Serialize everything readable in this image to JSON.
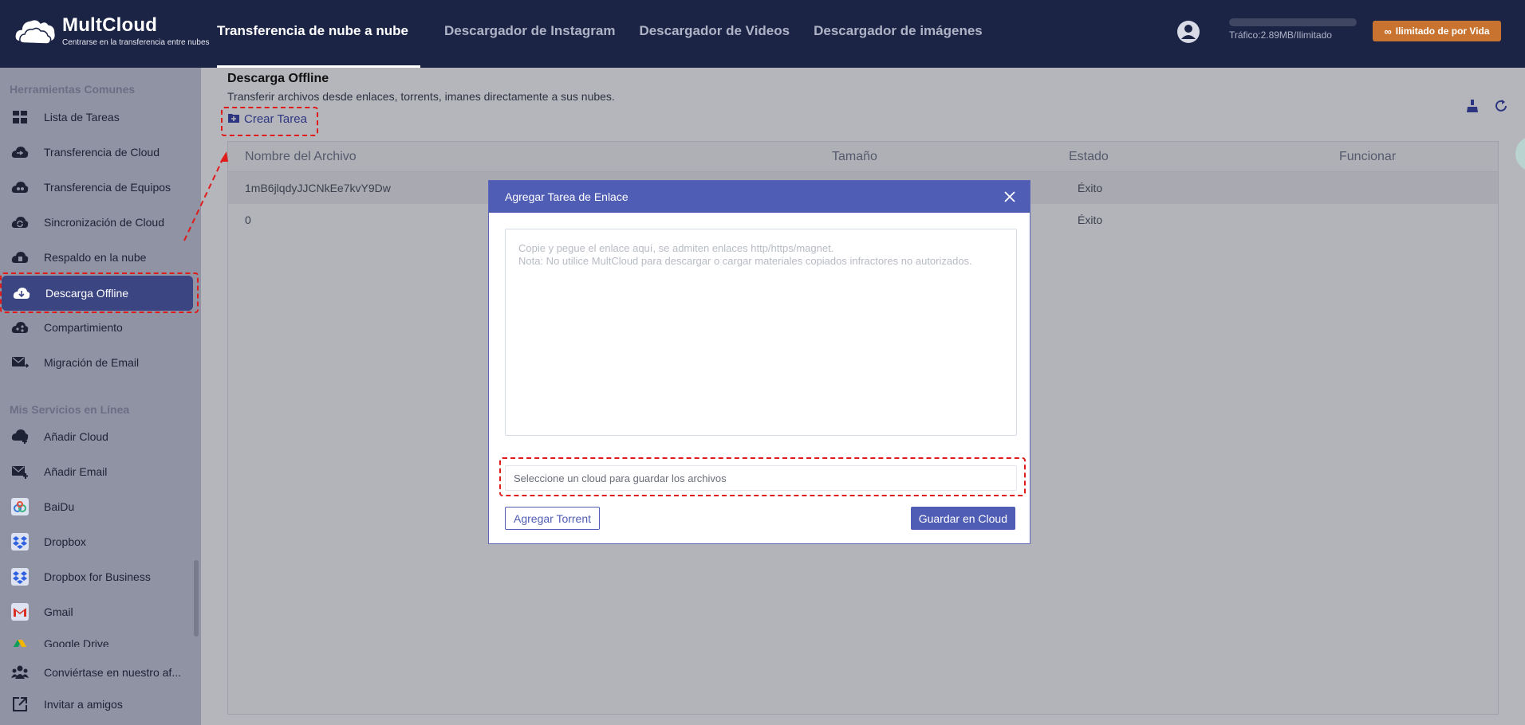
{
  "header": {
    "logo_title": "MultCloud",
    "logo_subtitle": "Centrarse en la transferencia entre nubes",
    "nav": [
      {
        "label": "Transferencia de nube a nube",
        "active": true
      },
      {
        "label": "Descargador de Instagram"
      },
      {
        "label": "Descargador de Videos"
      },
      {
        "label": "Descargador de imágenes"
      }
    ],
    "traffic": "Tráfico:2.89MB/Ilimitado",
    "vip_label": "Ilimitado de por Vida"
  },
  "sidebar": {
    "section_tools": "Herramientas Comunes",
    "tools": [
      {
        "label": "Lista de Tareas",
        "icon": "grid-icon"
      },
      {
        "label": "Transferencia de Cloud",
        "icon": "cloud-transfer-icon"
      },
      {
        "label": "Transferencia de Equipos",
        "icon": "team-transfer-icon"
      },
      {
        "label": "Sincronización de Cloud",
        "icon": "cloud-sync-icon"
      },
      {
        "label": "Respaldo en la nube",
        "icon": "cloud-backup-icon"
      },
      {
        "label": "Descarga Offline",
        "icon": "cloud-download-icon",
        "active": true
      },
      {
        "label": "Compartimiento",
        "icon": "share-icon"
      },
      {
        "label": "Migración de Email",
        "icon": "email-migration-icon"
      }
    ],
    "section_services": "Mis Servicios en Línea",
    "services": [
      {
        "label": "Añadir Cloud",
        "icon": "add-cloud-icon"
      },
      {
        "label": "Añadir Email",
        "icon": "add-email-icon"
      },
      {
        "label": "BaiDu",
        "icon": "baidu-icon"
      },
      {
        "label": "Dropbox",
        "icon": "dropbox-icon"
      },
      {
        "label": "Dropbox for Business",
        "icon": "dropbox-business-icon"
      },
      {
        "label": "Gmail",
        "icon": "gmail-icon"
      },
      {
        "label": "Google Drive",
        "icon": "google-drive-icon"
      }
    ],
    "bottom": [
      {
        "label": "Conviértase en nuestro af...",
        "icon": "affiliate-icon"
      },
      {
        "label": "Invitar a amigos",
        "icon": "invite-icon"
      }
    ]
  },
  "main": {
    "title": "Descarga Offline",
    "subtitle": "Transferir archivos desde enlaces, torrents, imanes directamente a sus nubes.",
    "create_task": "Crear Tarea",
    "columns": [
      "Nombre del Archivo",
      "Tamaño",
      "Estado",
      "Funcionar"
    ],
    "rows": [
      {
        "name": "1mB6jlqdyJJCNkEe7kvY9Dw",
        "size": "",
        "status": "Éxito"
      },
      {
        "name": "0",
        "size": "",
        "status": "Éxito"
      }
    ]
  },
  "modal": {
    "title": "Agregar Tarea de Enlace",
    "placeholder_line1": "Copie y pegue el enlace aquí, se admiten enlaces http/https/magnet.",
    "placeholder_line2": "Nota: No utilice MultCloud para descargar o cargar materiales copiados infractores no autorizados.",
    "select_placeholder": "Seleccione un cloud para guardar los archivos",
    "add_torrent": "Agregar Torrent",
    "save_to_cloud": "Guardar en Cloud"
  },
  "colors": {
    "topbar": "#1c2446",
    "accent": "#4f5db4",
    "vip": "#c87430",
    "highlight": "#e01b1b"
  }
}
